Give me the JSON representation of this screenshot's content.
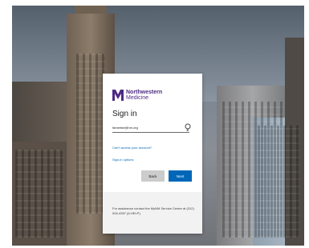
{
  "brand": {
    "line1": "Northwestern",
    "line2": "Medicine",
    "color": "#4e2a84"
  },
  "signin": {
    "title": "Sign in",
    "username_value": "fameeke@nm.org",
    "cant_access_link": "Can't access your account?",
    "options_link": "Sign-in options",
    "back_label": "Back",
    "next_label": "Next",
    "accent": "#0067b8"
  },
  "footer": {
    "assistance_text": "For assistance contact the MyNM Service Center at (312) 926-4357 (6-HELP)."
  },
  "icons": {
    "field": "key-icon",
    "logo": "nm-logo-icon"
  }
}
